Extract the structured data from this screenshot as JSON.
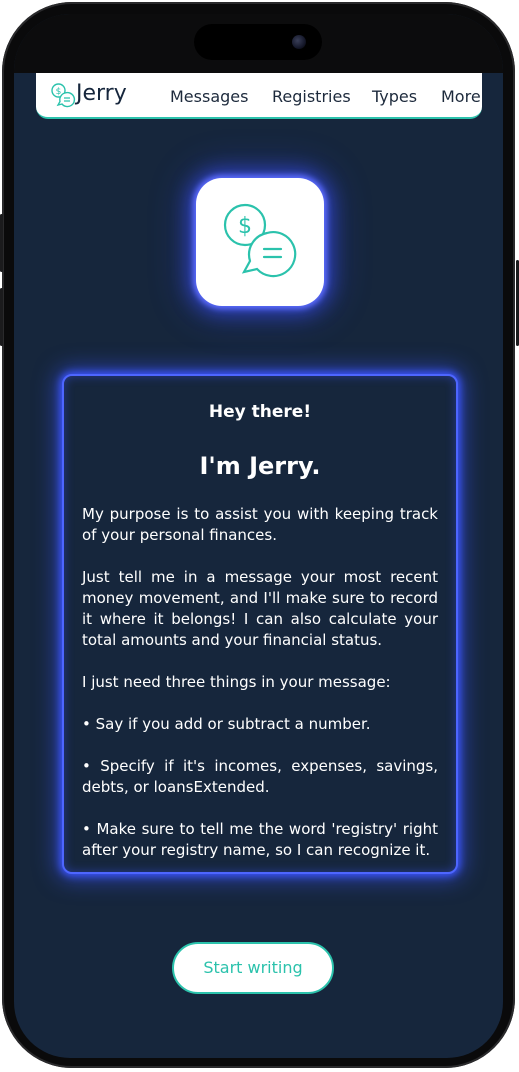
{
  "nav": {
    "brand": "Jerry",
    "items": [
      {
        "label": "Messages"
      },
      {
        "label": "Registries"
      },
      {
        "label": "Types"
      },
      {
        "label": "More"
      }
    ]
  },
  "icons": {
    "logo": "chat-money-bubbles-icon",
    "app": "chat-money-bubbles-icon"
  },
  "intro": {
    "greeting": "Hey there!",
    "title": "I'm Jerry.",
    "paragraphs": [
      "My purpose is to assist you with keeping track of your personal finances.",
      "Just tell me in a message your most recent money movement, and I'll make sure to record it where it belongs! I can also calculate your total amounts and your financial status.",
      "I just need three things in your message:",
      "• Say if you add or subtract a number.",
      "• Specify if it's incomes, expenses, savings, debts, or loansExtended.",
      "• Make sure to tell me the word 'registry' right after your registry name, so I can recognize it."
    ]
  },
  "cta": {
    "label": "Start writing"
  },
  "colors": {
    "accent": "#2bc2ac",
    "background": "#16263c",
    "glow": "#4e66ff"
  }
}
